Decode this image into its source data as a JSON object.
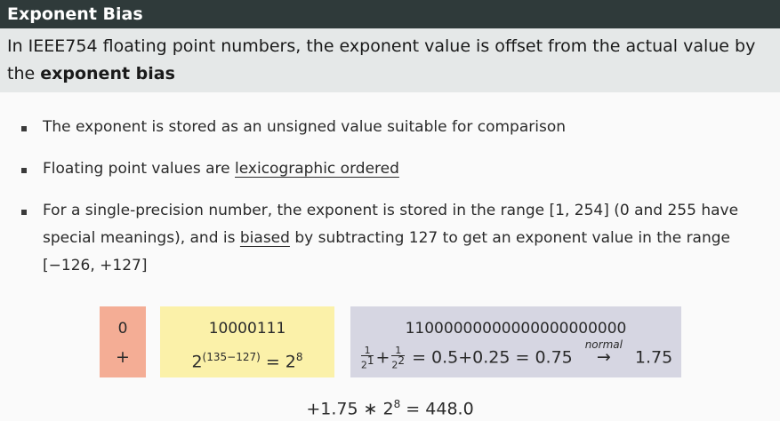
{
  "title": "Exponent Bias",
  "definition": {
    "text_before": "In IEEE754 floating point numbers, the exponent value is offset from the actual value by the ",
    "bold": "exponent bias"
  },
  "bullets": [
    {
      "pre": "The exponent is stored as an unsigned value suitable for comparison",
      "ul": "",
      "post": ""
    },
    {
      "pre": "Floating point values are ",
      "ul": "lexicographic ordered",
      "post": ""
    },
    {
      "pre": "For a single-precision number, the exponent is stored in the range [1, 254] (0 and 255 have special meanings), and is ",
      "ul": "biased",
      "post": " by subtracting 127 to get an exponent value in the range [−126, +127]"
    }
  ],
  "example": {
    "sign": {
      "bits": "0",
      "value": "+"
    },
    "exponent": {
      "bits": "10000111",
      "value_base": "2",
      "value_exp": "(135−127)",
      "equals": "= 2",
      "result_exp": "8"
    },
    "mantissa": {
      "bits": "11000000000000000000000",
      "frac1_num": "1",
      "frac1_den": "2",
      "frac1_den_exp": "1",
      "frac2_num": "1",
      "frac2_den": "2",
      "frac2_den_exp": "2",
      "sum_text": "= 0.5+0.25 = 0.75",
      "arrow_note": "normal",
      "arrow": "→",
      "final": "1.75"
    },
    "result": {
      "prefix": "+1.75 ∗ 2",
      "exp": "8",
      "suffix": " = 448.0"
    }
  }
}
